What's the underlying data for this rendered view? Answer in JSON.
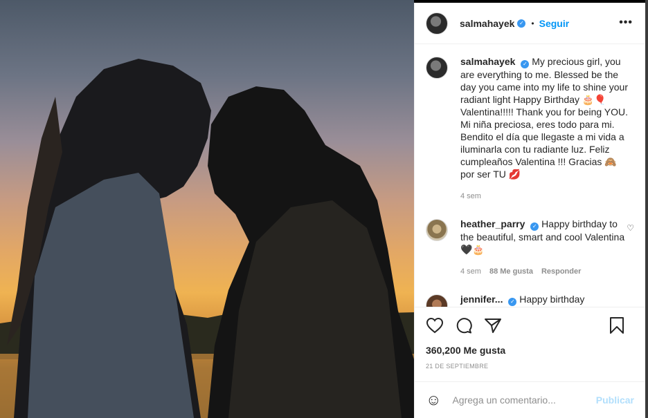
{
  "colors": {
    "accent": "#0095f6",
    "verified": "#3897f0",
    "muted": "#8e8e8e",
    "publish_disabled": "#b2dffc"
  },
  "header": {
    "username": "salmahayek",
    "follow_label": "Seguir",
    "dot": "•",
    "more_icon": "more-horizontal-icon"
  },
  "caption": {
    "username": "salmahayek",
    "text": "My precious girl, you are everything to me. Blessed be the day you came into my life to shine your radiant light Happy Birthday 🎂🎈 Valentina!!!!! Thank you for being YOU. Mi niña preciosa, eres todo para mi. Bendito el día que llegaste a mi vida a iluminarla con tu radiante luz. Feliz cumpleaños Valentina !!! Gracias 🙈 por ser TU 💋",
    "time": "4 sem"
  },
  "comments": [
    {
      "username": "heather_parry",
      "text": "Happy birthday to the beautiful, smart and cool Valentina 🖤🎂",
      "time": "4 sem",
      "likes": "88 Me gusta",
      "reply_label": "Responder"
    },
    {
      "username": "jennifer...",
      "text": "Happy birthday",
      "time": ""
    }
  ],
  "actions": {
    "likes": "360,200 Me gusta",
    "date": "21 DE SEPTIEMBRE"
  },
  "add_comment": {
    "placeholder": "Agrega un comentario...",
    "publish_label": "Publicar"
  }
}
